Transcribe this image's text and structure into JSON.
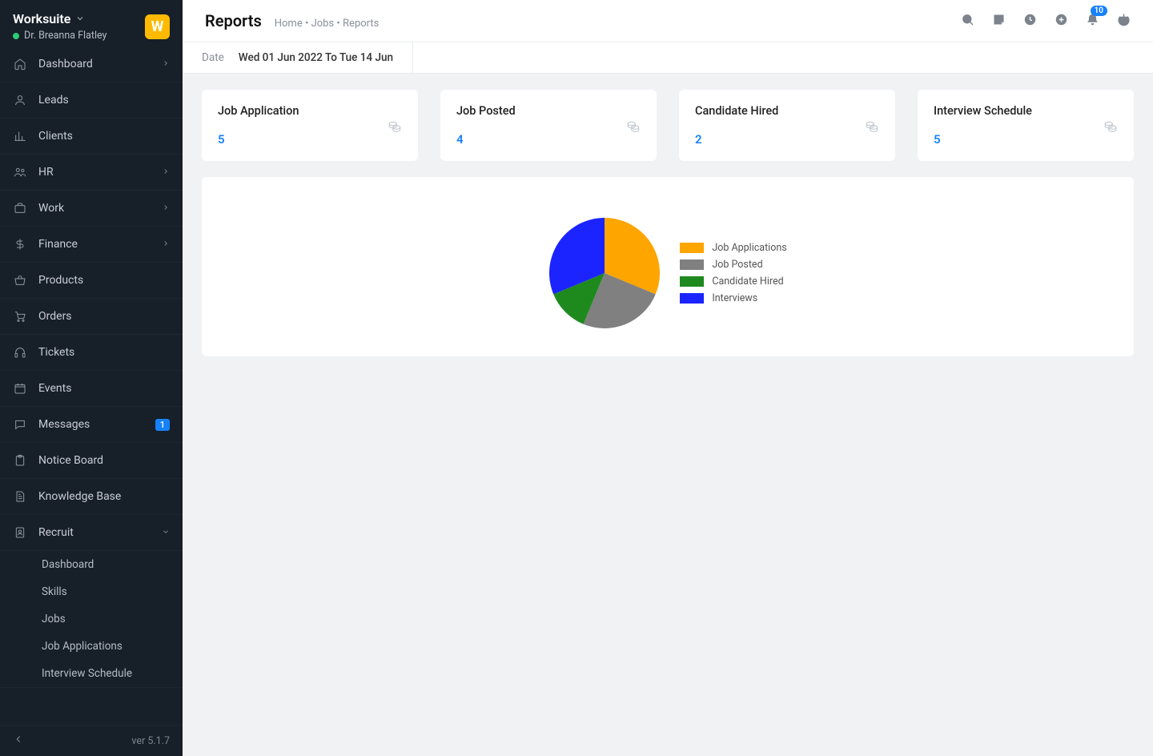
{
  "brand": {
    "name": "Worksuite",
    "user": "Dr. Breanna Flatley",
    "logo_letter": "W"
  },
  "sidebar": {
    "items": [
      {
        "label": "Dashboard",
        "icon": "home",
        "chevron": true
      },
      {
        "label": "Leads",
        "icon": "user",
        "chevron": false
      },
      {
        "label": "Clients",
        "icon": "chart",
        "chevron": false
      },
      {
        "label": "HR",
        "icon": "hr",
        "chevron": true
      },
      {
        "label": "Work",
        "icon": "briefcase",
        "chevron": true
      },
      {
        "label": "Finance",
        "icon": "dollar",
        "chevron": true
      },
      {
        "label": "Products",
        "icon": "basket",
        "chevron": false
      },
      {
        "label": "Orders",
        "icon": "cart",
        "chevron": false
      },
      {
        "label": "Tickets",
        "icon": "headphones",
        "chevron": false
      },
      {
        "label": "Events",
        "icon": "calendar",
        "chevron": false
      },
      {
        "label": "Messages",
        "icon": "message",
        "chevron": false,
        "badge": "1"
      },
      {
        "label": "Notice Board",
        "icon": "clipboard",
        "chevron": false
      },
      {
        "label": "Knowledge Base",
        "icon": "document",
        "chevron": false
      },
      {
        "label": "Recruit",
        "icon": "recruit",
        "chevron": false,
        "expanded": true
      }
    ],
    "recruit_sub": [
      "Dashboard",
      "Skills",
      "Jobs",
      "Job Applications",
      "Interview Schedule"
    ]
  },
  "footer": {
    "version": "ver 5.1.7"
  },
  "header": {
    "title": "Reports",
    "breadcrumb": {
      "home": "Home",
      "jobs": "Jobs",
      "current": "Reports",
      "sep": "•"
    },
    "notif_count": "10"
  },
  "datebar": {
    "label": "Date",
    "value": "Wed 01 Jun 2022 To Tue 14 Jun"
  },
  "cards": [
    {
      "title": "Job Application",
      "value": "5"
    },
    {
      "title": "Job Posted",
      "value": "4"
    },
    {
      "title": "Candidate Hired",
      "value": "2"
    },
    {
      "title": "Interview Schedule",
      "value": "5"
    }
  ],
  "chart_data": {
    "type": "pie",
    "title": "",
    "series": [
      {
        "name": "Job Applications",
        "value": 5,
        "color": "#ffa500"
      },
      {
        "name": "Job Posted",
        "value": 4,
        "color": "#808080"
      },
      {
        "name": "Candidate Hired",
        "value": 2,
        "color": "#1e8a1e"
      },
      {
        "name": "Interviews",
        "value": 5,
        "color": "#1b24ff"
      }
    ]
  }
}
